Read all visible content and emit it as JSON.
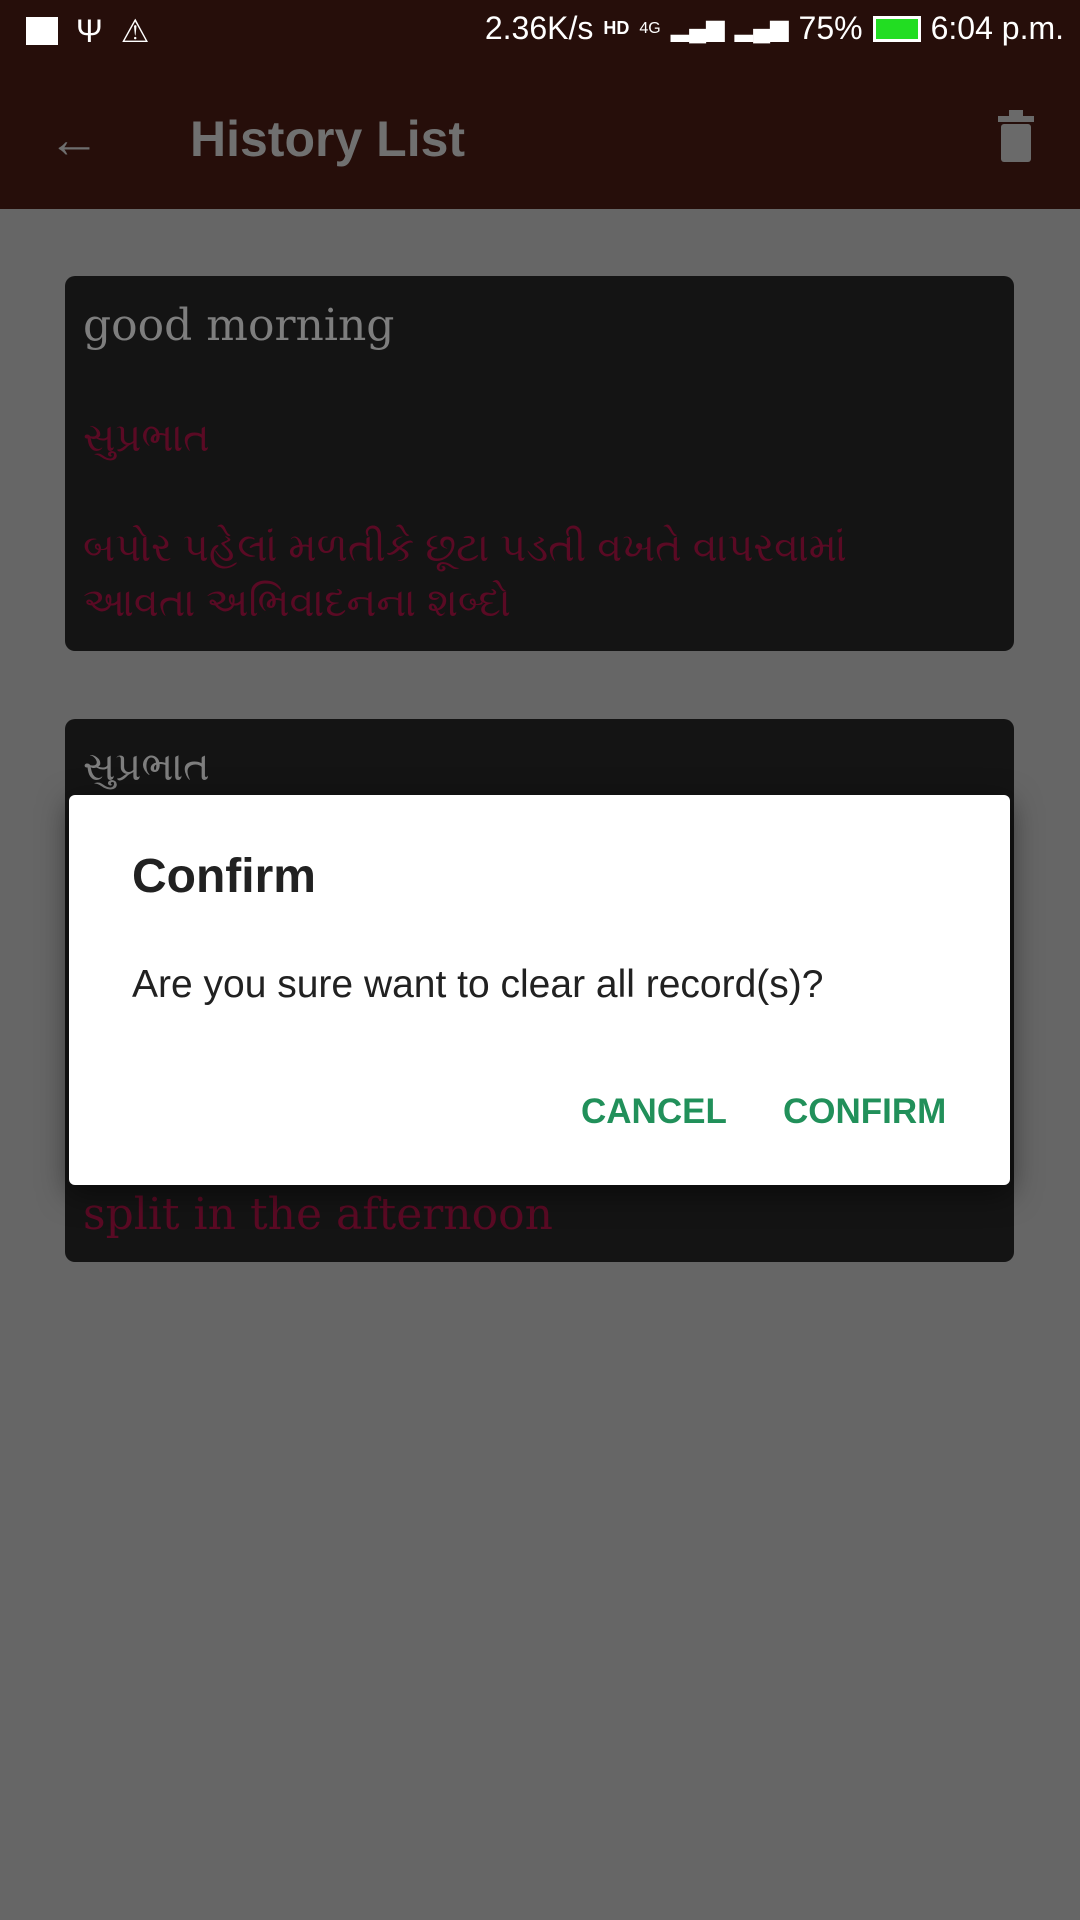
{
  "status_bar": {
    "net_speed": "2.36K/s",
    "network": "4G",
    "battery": "75%",
    "time": "6:04 p.m.",
    "icons": [
      "image-icon",
      "usb-icon",
      "warning-icon",
      "hd-call-icon",
      "signal-icon",
      "signal-icon",
      "battery-icon"
    ],
    "battery_color": "#22dd22"
  },
  "app_bar": {
    "title": "History List",
    "back_icon": "arrow-left-icon",
    "delete_icon": "trash-icon"
  },
  "history": [
    {
      "word": "good morning",
      "translation": "સુપ્રભાત",
      "meaning_line1": "બપોર પહેલાં મળતીકે છૂટા પડતી વખતે વાપરવામાં",
      "meaning_line2": "આવતા અભિવાદનના શબ્દો"
    },
    {
      "word": "સુપ્રભાત",
      "meaning": "split in the afternoon"
    }
  ],
  "dialog": {
    "title": "Confirm",
    "message": "Are you sure want to clear all record(s)?",
    "cancel": "CANCEL",
    "confirm": "CONFIRM",
    "accent": "#21905a"
  }
}
